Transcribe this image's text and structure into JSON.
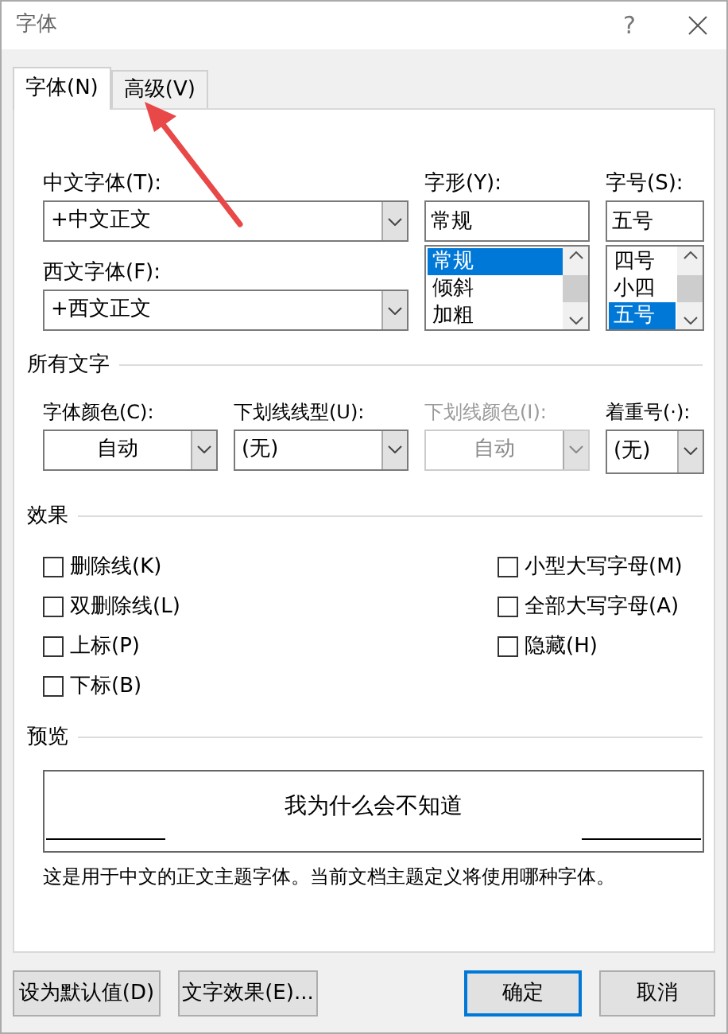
{
  "window": {
    "title": "字体",
    "help": "?"
  },
  "tabs": [
    {
      "label": "字体(N)",
      "selected": true
    },
    {
      "label": "高级(V)",
      "selected": false
    }
  ],
  "chinese_font": {
    "label": "中文字体(T):",
    "value": "+中文正文"
  },
  "western_font": {
    "label": "西文字体(F):",
    "value": "+西文正文"
  },
  "font_style": {
    "label": "字形(Y):",
    "value": "常规",
    "options": [
      {
        "label": "常规",
        "selected": true
      },
      {
        "label": "倾斜",
        "selected": false
      },
      {
        "label": "加粗",
        "selected": false
      }
    ]
  },
  "font_size": {
    "label": "字号(S):",
    "value": "五号",
    "options": [
      {
        "label": "四号",
        "selected": false
      },
      {
        "label": "小四",
        "selected": false
      },
      {
        "label": "五号",
        "selected": true
      }
    ]
  },
  "all_text": {
    "heading": "所有文字",
    "dropdowns": [
      {
        "label": "字体颜色(C):",
        "value": "自动",
        "disabled": false,
        "centered": true
      },
      {
        "label": "下划线线型(U):",
        "value": "(无)",
        "disabled": false,
        "centered": false
      },
      {
        "label": "下划线颜色(I):",
        "value": "自动",
        "disabled": true,
        "centered": true
      },
      {
        "label": "着重号(·):",
        "value": "(无)",
        "disabled": false,
        "centered": false
      }
    ]
  },
  "effects": {
    "heading": "效果",
    "left": [
      {
        "label": "删除线(K)",
        "checked": false
      },
      {
        "label": "双删除线(L)",
        "checked": false
      },
      {
        "label": "上标(P)",
        "checked": false
      },
      {
        "label": "下标(B)",
        "checked": false
      }
    ],
    "right": [
      {
        "label": "小型大写字母(M)",
        "checked": false
      },
      {
        "label": "全部大写字母(A)",
        "checked": false
      },
      {
        "label": "隐藏(H)",
        "checked": false
      }
    ]
  },
  "preview": {
    "heading": "预览",
    "sample": "我为什么会不知道",
    "description": "这是用于中文的正文主题字体。当前文档主题定义将使用哪种字体。"
  },
  "buttons": [
    {
      "label": "设为默认值(D)",
      "focused": false
    },
    {
      "label": "文字效果(E)...",
      "focused": false
    },
    {
      "label": "确定",
      "focused": true
    },
    {
      "label": "取消",
      "focused": false
    }
  ]
}
